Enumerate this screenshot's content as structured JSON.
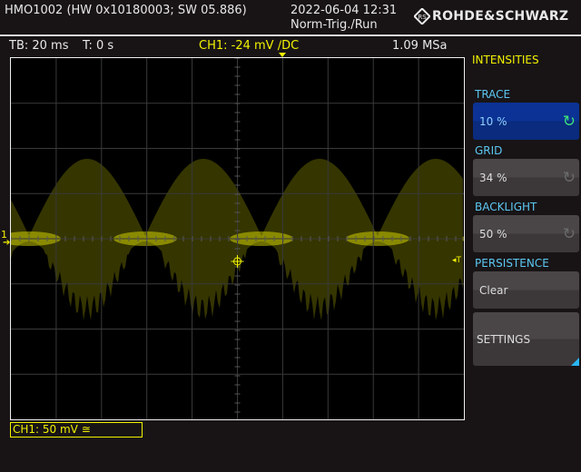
{
  "header": {
    "device": "HMO1002 (HW 0x10180003; SW 05.886)",
    "datetime": "2022-06-04 12:31",
    "trigger_state": "Norm-Trig./Run",
    "brand": "ROHDE&SCHWARZ"
  },
  "status": {
    "timebase": "TB: 20 ms",
    "time_offset": "T: 0 s",
    "trigger": "CH1: -24 mV ∕DC",
    "sample_rate": "1.09 MSa"
  },
  "scope": {
    "channel_marker": "1",
    "trigger_marker": "T",
    "grid_divisions": {
      "x": 10,
      "y": 8
    },
    "trace_color": "#f2f200"
  },
  "channel_box": {
    "label": "CH1: 50 mV ≅"
  },
  "menu": {
    "title": "INTENSITIES",
    "trace": {
      "label": "TRACE",
      "value": "10 %"
    },
    "grid": {
      "label": "GRID",
      "value": "34 %"
    },
    "backlight": {
      "label": "BACKLIGHT",
      "value": "50 %"
    },
    "persistence": {
      "label": "PERSISTENCE",
      "value": "Clear"
    },
    "settings": {
      "label": "SETTINGS"
    }
  },
  "colors": {
    "accent_blue": "#0b3294",
    "label_blue": "#5cc8f2",
    "yellow": "#f2f200"
  }
}
